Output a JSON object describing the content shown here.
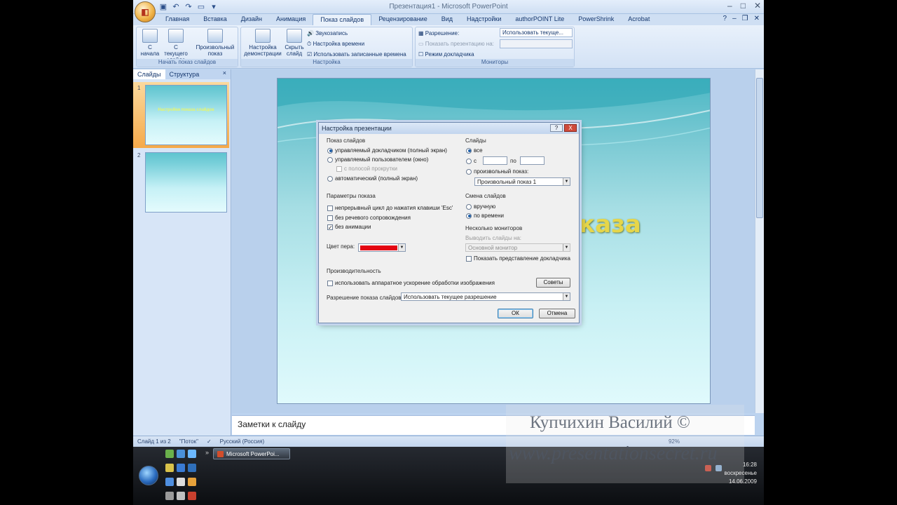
{
  "window": {
    "title": "Презентация1 - Microsoft PowerPoint"
  },
  "ribbon_tabs": [
    "Главная",
    "Вставка",
    "Дизайн",
    "Анимация",
    "Показ слайдов",
    "Рецензирование",
    "Вид",
    "Надстройки",
    "authorPOINT Lite",
    "PowerShrink",
    "Acrobat"
  ],
  "ribbon": {
    "start_group": {
      "label": "Начать показ слайдов",
      "from_start": "С начала",
      "from_current": "С текущего слайда",
      "custom_show": "Произвольный показ"
    },
    "setup_group": {
      "label": "Настройка",
      "setup_show": "Настройка демонстрации",
      "hide_slide": "Скрыть слайд",
      "record_narration": "Звукозапись",
      "rehearse_timings": "Настройка времени",
      "use_timings": "Использовать записанные времена"
    },
    "monitors_group": {
      "label": "Мониторы",
      "resolution_label": "Разрешение:",
      "resolution_value": "Использовать текуще...",
      "show_on_label": "Показать презентацию на:",
      "presenter_view": "Режим докладчика"
    }
  },
  "slides_pane": {
    "tab_slides": "Слайды",
    "tab_outline": "Структура",
    "close": "×",
    "thumbnails": [
      {
        "num": "1",
        "title": "Настройки показа слайдов"
      },
      {
        "num": "2",
        "title": ""
      }
    ]
  },
  "slide": {
    "visible_title_fragment": "каза"
  },
  "notes": {
    "placeholder": "Заметки к слайду"
  },
  "status_bar": {
    "slide_info": "Слайд 1 из 2",
    "theme": "\"Поток\"",
    "language": "Русский (Россия)",
    "zoom": "92%"
  },
  "dialog": {
    "title": "Настройка презентации",
    "help": "?",
    "close": "X",
    "show_type": {
      "label": "Показ слайдов",
      "opt1": "управляемый докладчиком (полный экран)",
      "opt2": "управляемый пользователем (окно)",
      "opt2_sub": "с полосой прокрутки",
      "opt3": "автоматический (полный экран)"
    },
    "slides": {
      "label": "Слайды",
      "all": "все",
      "from": "с",
      "to": "по",
      "custom": "произвольный показ:",
      "custom_value": "Произвольный показ 1"
    },
    "show_options": {
      "label": "Параметры показа",
      "loop": "непрерывный цикл до нажатия клавиши 'Esc'",
      "no_narration": "без речевого сопровождения",
      "no_animation": "без анимации",
      "pen_color": "Цвет пера:"
    },
    "advance": {
      "label": "Смена слайдов",
      "manual": "вручную",
      "timings": "по времени"
    },
    "monitors": {
      "label": "Несколько мониторов",
      "display_on": "Выводить слайды на:",
      "display_value": "Основной монитор",
      "presenter_view": "Показать представление докладчика"
    },
    "performance": {
      "label": "Производительность",
      "hw_accel": "использовать аппаратное ускорение обработки изображения",
      "tips": "Советы",
      "resolution_label": "Разрешение показа слайдов:",
      "resolution_value": "Использовать текущее разрешение"
    },
    "ok": "ОК",
    "cancel": "Отмена",
    "pen_color_hex": "#e30613"
  },
  "taskbar": {
    "app": "Microsoft PowerPoi...",
    "time": "16:28",
    "day": "воскресенье",
    "date": "14.06.2009"
  },
  "watermark": {
    "author": "Купчихин Василий ©",
    "site": "www.presentationsecret.ru"
  }
}
